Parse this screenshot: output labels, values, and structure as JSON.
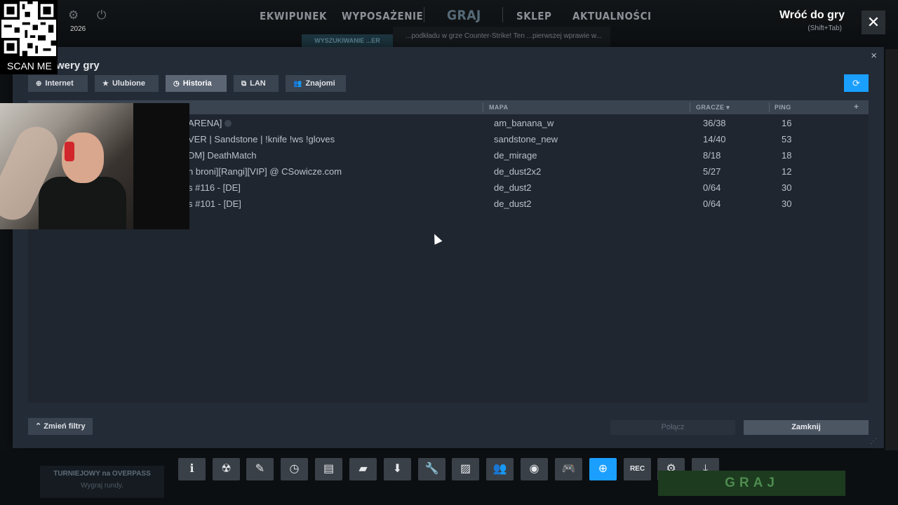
{
  "topnav": {
    "items": [
      "EKWIPUNEK",
      "WYPOSAŻENIE",
      "GRAJ",
      "SKLEP",
      "AKTUALNOŚCI"
    ],
    "back_title": "Wróć do gry",
    "back_hint": "(Shift+Tab)",
    "close_icon": "✕"
  },
  "overlay": {
    "scan_label": "SCAN ME",
    "year": "2026",
    "banner_left": "WYSZUKIWANIE ...ER",
    "banner_text": "...podkładu w grze Counter-Strike! Ten ...pierwszej wprawie w..."
  },
  "dialog": {
    "title": "wery gry",
    "close_icon": "×",
    "tabs": [
      {
        "label": "Internet",
        "icon": "globe-icon"
      },
      {
        "label": "Ulubione",
        "icon": "star-icon"
      },
      {
        "label": "Historia",
        "icon": "history-icon",
        "active": true
      },
      {
        "label": "LAN",
        "icon": "lan-icon"
      },
      {
        "label": "Znajomi",
        "icon": "friends-icon"
      }
    ],
    "columns": {
      "map": "MAPA",
      "players": "GRACZE ▾",
      "ping": "PING",
      "add": "+"
    },
    "rows": [
      {
        "name": "ARENA]",
        "map": "am_banana_w",
        "players": "36/38",
        "ping": "16"
      },
      {
        "name": "VER | Sandstone | !knife !ws !gloves",
        "map": "sandstone_new",
        "players": "14/40",
        "ping": "53"
      },
      {
        "name": "DM]  DeathMatch",
        "map": "de_mirage",
        "players": "8/18",
        "ping": "18"
      },
      {
        "name": "n broni][Rangi][VIP] @ CSowicze.com",
        "map": "de_dust2x2",
        "players": "5/27",
        "ping": "12"
      },
      {
        "name": "s #116 - [DE]",
        "map": "de_dust2",
        "players": "0/64",
        "ping": "30"
      },
      {
        "name": "s #101 - [DE]",
        "map": "de_dust2",
        "players": "0/64",
        "ping": "30"
      }
    ],
    "filters_label": "Zmień filtry",
    "connect_label": "Połącz",
    "close_label": "Zamknij"
  },
  "bottom": {
    "tourney_title": "TURNIEJOWY na OVERPASS",
    "tourney_sub": "Wygraj rundy.",
    "play_label": "GRAJ",
    "toolbar": [
      "info-icon",
      "radioactive-icon",
      "pencil-icon",
      "clock-icon",
      "notebook-icon",
      "chat-icon",
      "download-icon",
      "wrench-icon",
      "image-icon",
      "people-icon",
      "eye-icon",
      "gamepad-icon",
      "globe-icon",
      "rec-icon",
      "gear-icon",
      "minimize-icon"
    ]
  },
  "colors": {
    "accent": "#1a9fff",
    "panel": "#232b36",
    "header": "#3a4350"
  }
}
